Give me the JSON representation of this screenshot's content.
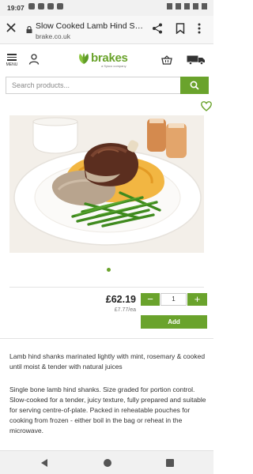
{
  "status_bar": {
    "time": "19:07"
  },
  "browser": {
    "page_title": "Slow Cooked Lamb Hind Sha...",
    "url": "brake.co.uk",
    "icons": [
      "close-icon",
      "lock-icon",
      "share-icon",
      "bookmark-icon",
      "more-vert-icon"
    ]
  },
  "site_header": {
    "menu_label": "MENU",
    "logo_text": "brakes",
    "logo_tagline": "a Sysco company",
    "icons": [
      "menu-icon",
      "account-icon",
      "basket-icon",
      "delivery-truck-icon"
    ]
  },
  "search": {
    "placeholder": "Search products..."
  },
  "product": {
    "price": "£62.19",
    "unit_price": "£7.77/ea",
    "quantity": "1",
    "qty_minus_label": "−",
    "qty_plus_label": "+",
    "add_label": "Add",
    "carousel_dots": 1,
    "description_1": "Lamb hind shanks marinated lightly with mint, rosemary & cooked until moist & tender with natural juices",
    "description_2": "Single bone lamb hind shanks. Size graded for portion control. Slow-cooked for a tender, juicy texture, fully prepared and suitable for serving centre-of-plate. Packed in reheatable pouches for cooking from frozen - either boil in the bag or reheat in the microwave."
  },
  "colors": {
    "brand_green": "#6aa32c",
    "text": "#222222"
  }
}
